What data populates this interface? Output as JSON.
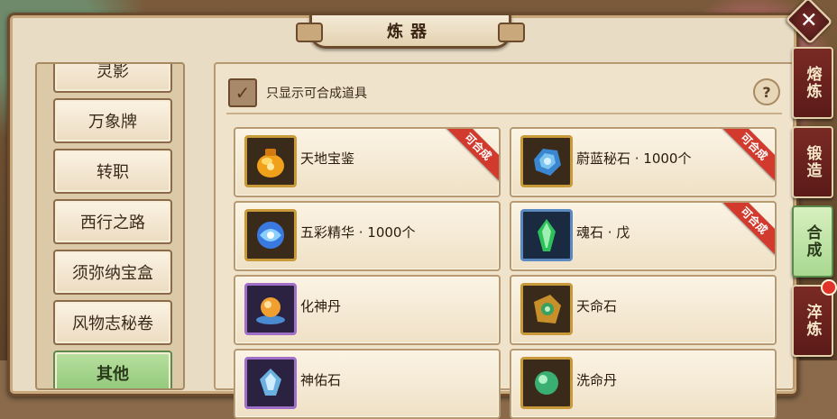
{
  "window": {
    "title": "炼器"
  },
  "categories": [
    {
      "label": "灵影"
    },
    {
      "label": "万象牌"
    },
    {
      "label": "转职"
    },
    {
      "label": "西行之路"
    },
    {
      "label": "须弥纳宝盒"
    },
    {
      "label": "风物志秘卷"
    },
    {
      "label": "其他",
      "active": true
    }
  ],
  "filter": {
    "label": "只显示可合成道具",
    "checked": true,
    "check_mark": "✓"
  },
  "help": {
    "label": "?"
  },
  "close": {
    "label": "✕"
  },
  "items": [
    {
      "name": "天地宝鉴",
      "craftable": true,
      "ribbon": "可合成",
      "icon": "golden-bag-icon"
    },
    {
      "name": "蔚蓝秘石 · 1000个",
      "craftable": true,
      "ribbon": "可合成",
      "icon": "blue-stone-icon"
    },
    {
      "name": "五彩精华 · 1000个",
      "craftable": false,
      "ribbon": "",
      "icon": "blue-orb-icon"
    },
    {
      "name": "魂石 · 戊",
      "craftable": true,
      "ribbon": "可合成",
      "icon": "green-crystal-icon"
    },
    {
      "name": "化神丹",
      "craftable": false,
      "ribbon": "",
      "icon": "orange-pill-icon"
    },
    {
      "name": "天命石",
      "craftable": false,
      "ribbon": "",
      "icon": "fate-stone-icon"
    },
    {
      "name": "神佑石",
      "craftable": false,
      "ribbon": "",
      "icon": "blessing-stone-icon"
    },
    {
      "name": "洗命丹",
      "craftable": false,
      "ribbon": "",
      "icon": "green-pill-icon"
    }
  ],
  "side_tabs": [
    {
      "label": "熔炼"
    },
    {
      "label": "锻造"
    },
    {
      "label": "合成",
      "active": true
    },
    {
      "label": "淬炼",
      "has_dot": true
    }
  ]
}
